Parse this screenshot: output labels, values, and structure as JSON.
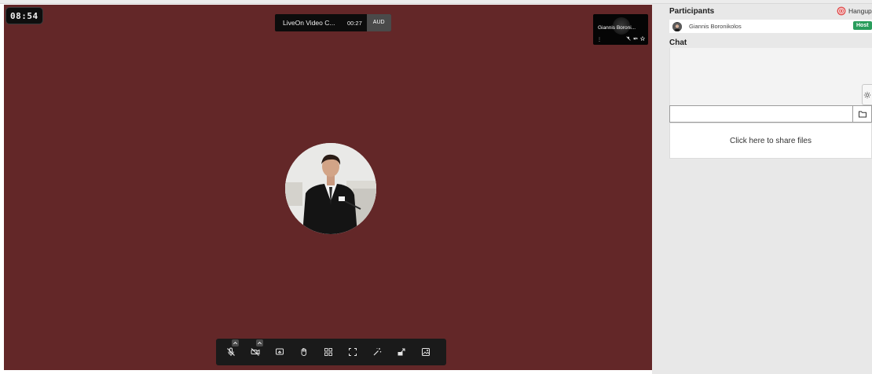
{
  "stage": {
    "timer": "08:54",
    "title": "LiveOn Video C...",
    "elapsed": "00:27",
    "quality": "AUD",
    "self_tile": {
      "name": "Giannis Boroni...",
      "menu": "⋮"
    }
  },
  "toolbar": {
    "buttons": [
      "mic-muted",
      "camera-off",
      "screen-share",
      "raise-hand",
      "tile-view",
      "fullscreen",
      "effects",
      "picture-in-picture",
      "background"
    ]
  },
  "sidebar": {
    "participants_title": "Participants",
    "hangup_label": "Hangup",
    "participants": [
      {
        "name": "Giannis Boronikolos",
        "badge": "Host"
      }
    ],
    "chat_title": "Chat",
    "chat_input": {
      "value": "",
      "placeholder": ""
    },
    "share_label": "Click here to share files"
  },
  "colors": {
    "stage_bg": "#632728",
    "host_badge": "#2a9d5c",
    "hangup_icon": "#e04848"
  }
}
